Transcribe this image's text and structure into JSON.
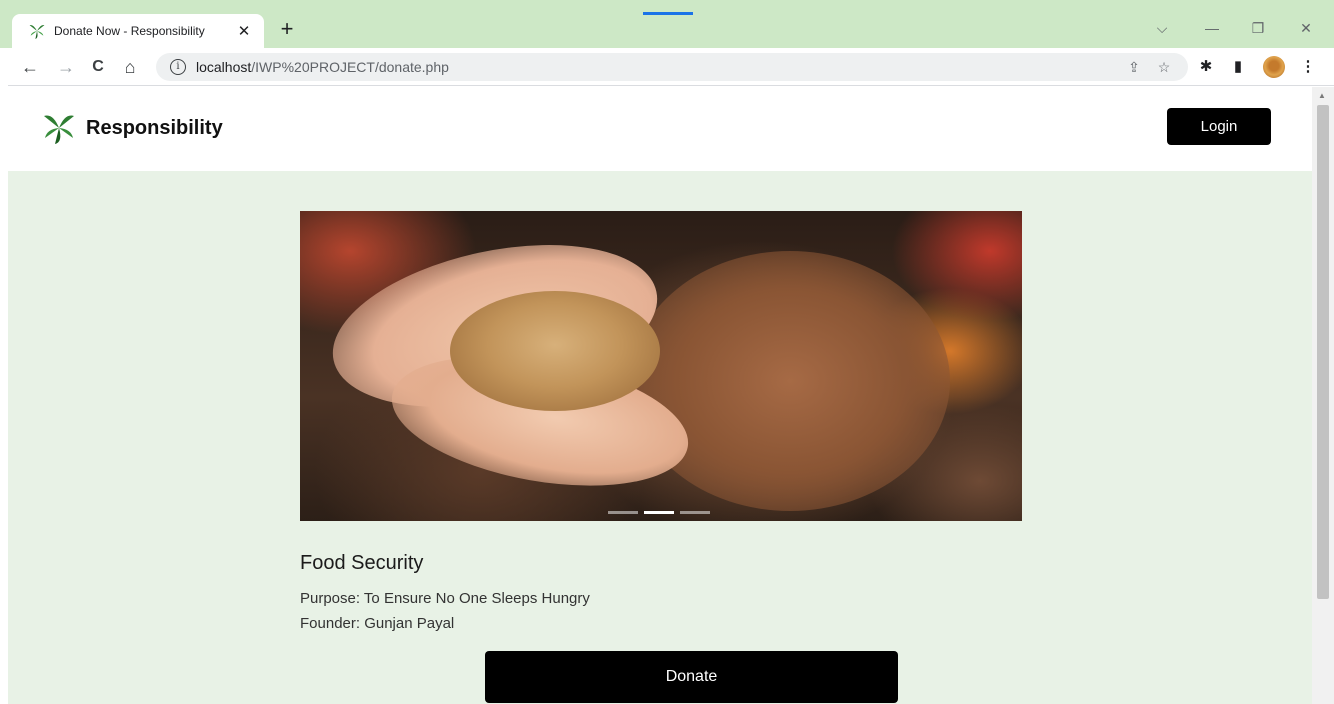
{
  "browser": {
    "tab": {
      "title": "Donate Now - Responsibility",
      "close": "✕",
      "favicon": "leaf-logo-icon"
    },
    "new_tab": "+",
    "window_controls": {
      "dropdown": "⌵",
      "minimize": "—",
      "restore": "❐",
      "close": "✕"
    },
    "nav": {
      "back": "←",
      "forward": "→",
      "reload": "C",
      "home": "⌂"
    },
    "address": {
      "host": "localhost",
      "path": "/IWP%20PROJECT/donate.php",
      "info_icon": "i"
    },
    "omnibox_icons": {
      "share": "⇪",
      "bookmark": "☆"
    },
    "toolbar_icons": {
      "extensions": "✱",
      "side_panel": "▮",
      "menu": "⋮"
    }
  },
  "site": {
    "brand": "Responsibility",
    "login_label": "Login"
  },
  "cause": {
    "title": "Food Security",
    "purpose": "Purpose: To Ensure No One Sleeps Hungry",
    "founder": "Founder: Gunjan Payal",
    "donate_label": "Donate",
    "carousel_active_slide": 2,
    "carousel_slide_count": 3
  },
  "colors": {
    "chrome_tab_strip": "#cde8c6",
    "content_background": "#e8f2e6",
    "button": "#000000",
    "logo_green": "#2e7d32"
  }
}
